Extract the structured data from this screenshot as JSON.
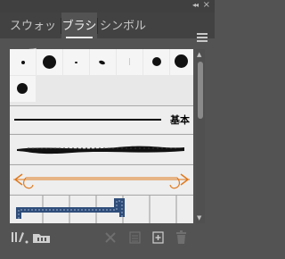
{
  "panel": {
    "tabs": [
      {
        "label": "スウォッチ",
        "active": false
      },
      {
        "label": "ブラシ",
        "active": true
      },
      {
        "label": "シンボル",
        "active": false
      }
    ],
    "collapse_glyph": "◂◂",
    "close_glyph": "×"
  },
  "brushes": {
    "calligraphic_dot_count": 7,
    "basic_label": "基本"
  },
  "colors": {
    "panel_bg": "#535353",
    "tabbar_bg": "#424242",
    "list_bg": "#e8e8e8",
    "arrow_accent": "#e07a1f",
    "pattern_blue": "#2f4d7a"
  },
  "toolbar_icons": [
    "brush-libraries-menu-icon",
    "open-library-icon",
    "remove-stroke-icon",
    "options-icon",
    "new-brush-icon",
    "delete-brush-icon"
  ]
}
